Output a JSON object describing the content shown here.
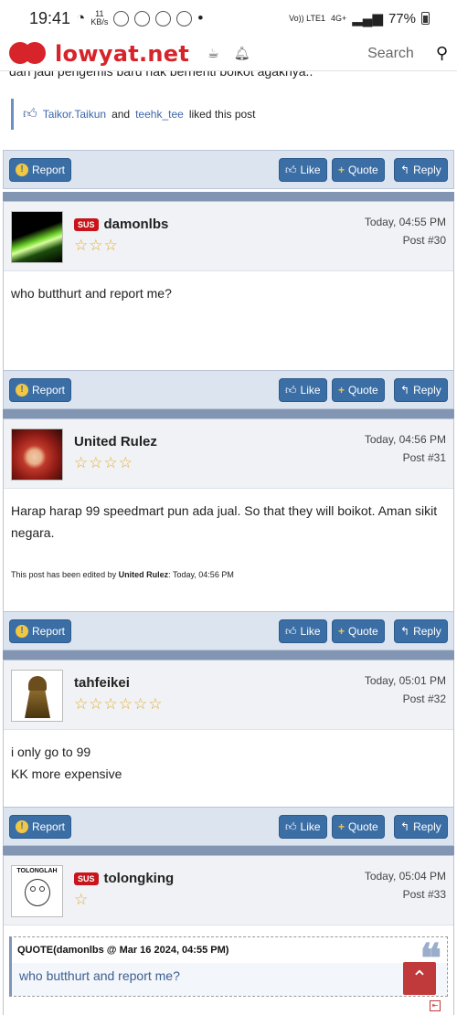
{
  "status_bar": {
    "time": "19:41",
    "net_speed": "11",
    "net_unit": "KB/s",
    "volte": "Vo)) LTE1",
    "network": "4G+",
    "battery": "77%"
  },
  "header": {
    "logo_text": "lowyat.net",
    "search_placeholder": "Search"
  },
  "prev_post": {
    "cut_text": "dan jadi pengemis baru nak berhenti boikot agaknya..",
    "liked_user1": "Taikor.Taikun",
    "liked_and": "and",
    "liked_user2": "teehk_tee",
    "liked_suffix": "liked this post"
  },
  "buttons": {
    "report": "Report",
    "like": "Like",
    "quote": "Quote",
    "reply": "Reply"
  },
  "posts": [
    {
      "username": "damonlbs",
      "badge": "SUS",
      "stars": "☆☆☆",
      "time": "Today, 04:55 PM",
      "post_no": "Post #30",
      "body": "who butthurt and report me?"
    },
    {
      "username": "United Rulez",
      "badge": "",
      "stars": "☆☆☆☆",
      "time": "Today, 04:56 PM",
      "post_no": "Post #31",
      "body": "Harap harap 99 speedmart pun ada jual. So that they will boikot. Aman sikit negara.",
      "edited_prefix": "This post has been edited by",
      "edited_by": "United Rulez",
      "edited_time": ": Today, 04:56 PM"
    },
    {
      "username": "tahfeikei",
      "badge": "",
      "stars": "☆☆☆☆☆☆",
      "time": "Today, 05:01 PM",
      "post_no": "Post #32",
      "body_line1": "i only go to 99",
      "body_line2": "KK more expensive"
    },
    {
      "username": "tolongking",
      "badge": "SUS",
      "stars": "☆",
      "time": "Today, 05:04 PM",
      "post_no": "Post #33",
      "quote_head": "QUOTE(damonlbs @ Mar 16 2024, 04:55 PM)",
      "quote_body": "who butthurt and report me?"
    }
  ],
  "avatar_caption": "TOLONGLAH",
  "colors": {
    "brand": "#d7232a",
    "button": "#3b6ea5",
    "separator": "#8296b4",
    "action_bar": "#dce5ef",
    "sus_badge": "#c8151b",
    "stars": "#e2ad2c"
  }
}
